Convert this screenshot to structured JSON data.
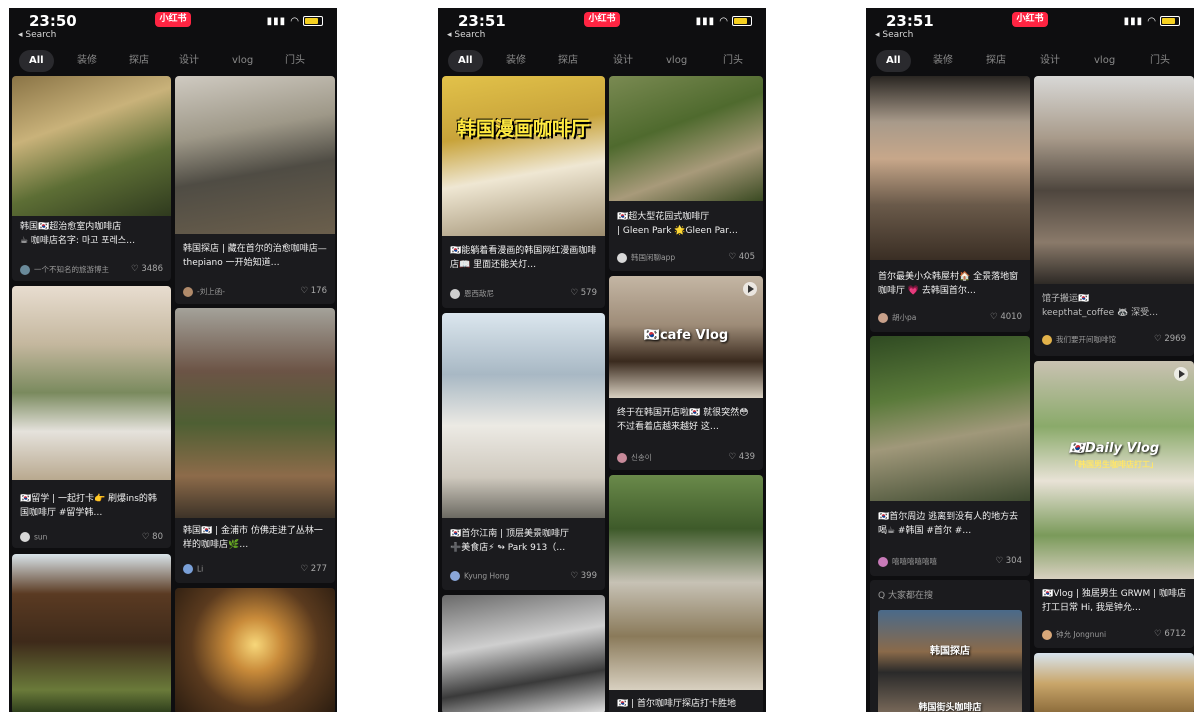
{
  "app": {
    "brand": "小红书",
    "back_label": "◂ Search"
  },
  "tabs": [
    "All",
    "装修",
    "探店",
    "设计",
    "vlog",
    "门头"
  ],
  "screens": [
    {
      "time": "23:50",
      "cards": [
        {
          "title": "韩国🇰🇷超治愈室内咖啡店\n☕ 咖啡店名字: 마고 포레스…",
          "author": "一个不知名的旅游博主",
          "likes": "3486"
        },
        {
          "title": "韩国探店 | 藏在首尔的治愈咖啡店—thepiano 一开始知道…",
          "author": "-刘上函-",
          "likes": "176"
        },
        {
          "title": "🇰🇷留学 | 一起打卡👉 刷爆ins的韩国咖啡厅 #留学韩…",
          "author": "sun",
          "likes": "80"
        },
        {
          "title": "韩国🇰🇷 | 金浦市 仿佛走进了丛林一样的咖啡店🌿…",
          "author": "Li",
          "likes": "277"
        },
        {
          "title": "",
          "author": "",
          "likes": ""
        },
        {
          "title": "",
          "author": "",
          "likes": ""
        }
      ]
    },
    {
      "time": "23:51",
      "overlay_manga": "韩国漫画咖啡厅",
      "overlay_cafe": "🇰🇷cafe Vlog",
      "cards": [
        {
          "title": "🇰🇷能躺着看漫画的韩国网红漫画咖啡店📖 里面还能关灯…",
          "author": "恩西敌尼",
          "likes": "579"
        },
        {
          "title": "🇰🇷超大型花园式咖啡厅\n| Gleen Park 🌟Gleen Par…",
          "author": "韩国闲聊app",
          "likes": "405"
        },
        {
          "title": "终于在韩国开店啦🇰🇷 就很突然😳 不过看着店越来越好 这…",
          "author": "신송이",
          "likes": "439"
        },
        {
          "title": "🇰🇷首尔江南 | 顶层美景咖啡厅\n➕美食店⚡ ↬ Park 913（…",
          "author": "Kyung Hong",
          "likes": "399"
        },
        {
          "title": "🇰🇷 | 首尔咖啡厅探店打卡胜地",
          "author": "",
          "likes": ""
        },
        {
          "title": "",
          "author": "",
          "likes": ""
        }
      ]
    },
    {
      "time": "23:51",
      "overlay_daily": "🇰🇷Daily Vlog",
      "overlay_daily_sub": "「韩国男生咖啡店打工」",
      "search_hint": "Q 大家都在搜",
      "search_tags": [
        "韩国探店",
        "韩国街头咖啡店"
      ],
      "cards": [
        {
          "title": "首尔最美小众韩屋村🏠 全景落地窗咖啡厅 💗 去韩国首尔…",
          "author": "胡小pa",
          "likes": "4010"
        },
        {
          "title": "馆子搬运🇰🇷\nkeepthat_coffee 🦝 深受…",
          "author": "我们要开间咖啡馆",
          "likes": "2969"
        },
        {
          "title": "🇰🇷首尔周边 逃离到没有人的地方去喝☕ #韩国 #首尔 #…",
          "author": "嘻嘻嘻嘻嘻嘻",
          "likes": "304"
        },
        {
          "title": "🇰🇷Vlog | 独居男生 GRWM | 咖啡店打工日常 Hi, 我是钟允…",
          "author": "钟允 Jongnuni",
          "likes": "6712"
        },
        {
          "title": "",
          "author": "",
          "likes": ""
        }
      ]
    }
  ],
  "colors": {
    "background": "#0e0e10",
    "card": "#1b1b1e",
    "brand": "#ff2442",
    "tab_active": "#2a2a2e"
  }
}
